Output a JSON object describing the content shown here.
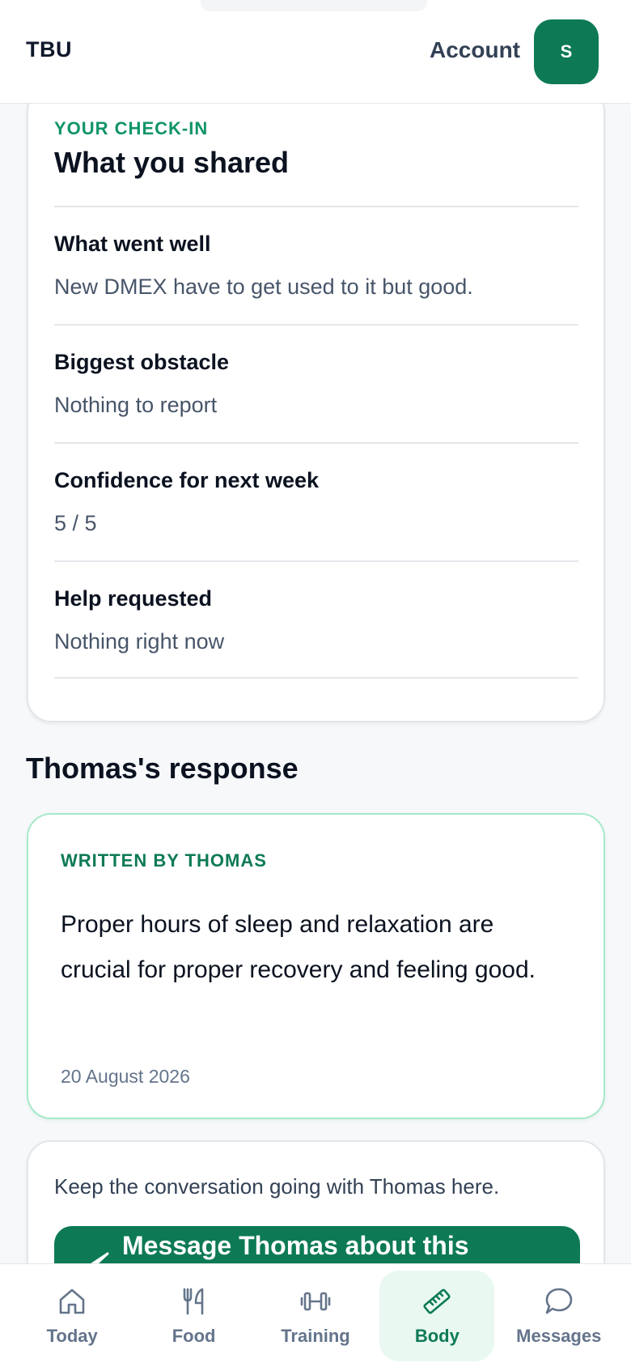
{
  "header": {
    "brand": "TBU",
    "account_label": "Account",
    "avatar_initial": "S"
  },
  "checkin": {
    "eyebrow": "YOUR CHECK-IN",
    "title": "What you shared",
    "items": [
      {
        "question": "What went well",
        "answer": "New DMEX have to get used to it but good."
      },
      {
        "question": "Biggest obstacle",
        "answer": "Nothing to report"
      },
      {
        "question": "Confidence for next week",
        "answer": "5 / 5"
      },
      {
        "question": "Help requested",
        "answer": "Nothing right now"
      }
    ]
  },
  "response": {
    "section_title": "Thomas's response",
    "eyebrow": "WRITTEN BY THOMAS",
    "body": "Proper hours of sleep and relaxation are crucial for proper recovery and feeling good.",
    "date": "20 August 2026"
  },
  "conversation": {
    "text": "Keep the conversation going with Thomas here.",
    "button_label": "Message Thomas about this"
  },
  "nav": {
    "items": [
      {
        "label": "Today",
        "icon": "home-icon",
        "active": false
      },
      {
        "label": "Food",
        "icon": "fork-knife-icon",
        "active": false
      },
      {
        "label": "Training",
        "icon": "dumbbell-icon",
        "active": false
      },
      {
        "label": "Body",
        "icon": "ruler-icon",
        "active": true
      },
      {
        "label": "Messages",
        "icon": "chat-bubble-icon",
        "active": false
      }
    ]
  },
  "colors": {
    "accent": "#0d7a55",
    "accent_light": "#10946a",
    "active_nav_bg": "#e9f8f1",
    "response_border": "#a7e9c9"
  }
}
